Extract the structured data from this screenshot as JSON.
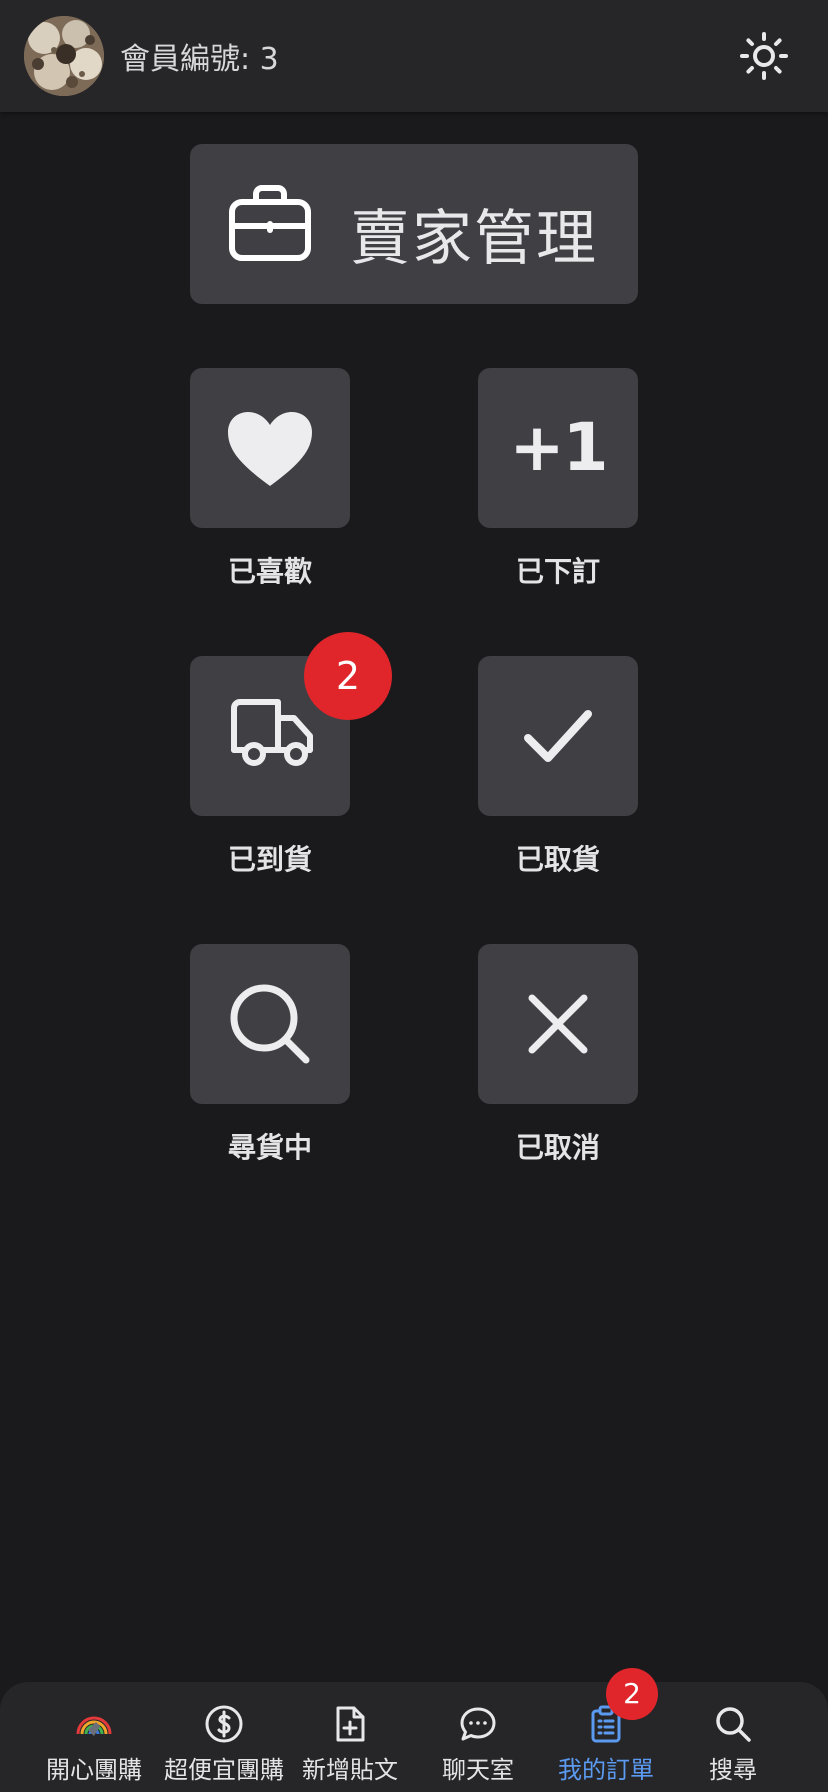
{
  "header": {
    "member_label": "會員編號: 3",
    "avatar_icon": "user-avatar-photo",
    "theme_icon": "sun-icon"
  },
  "seller": {
    "label": "賣家管理",
    "icon": "briefcase-icon"
  },
  "tiles": [
    {
      "label": "已喜歡",
      "icon": "heart-icon"
    },
    {
      "label": "已下訂",
      "icon": "plus-one-icon",
      "icon_text": "+1"
    },
    {
      "label": "已到貨",
      "icon": "truck-icon",
      "badge": "2"
    },
    {
      "label": "已取貨",
      "icon": "check-icon"
    },
    {
      "label": "尋貨中",
      "icon": "search-icon"
    },
    {
      "label": "已取消",
      "icon": "close-icon"
    }
  ],
  "bottom_nav": {
    "items": [
      {
        "label": "開心團購",
        "icon": "rainbow-icon"
      },
      {
        "label": "超便宜團購",
        "icon": "dollar-circle-icon"
      },
      {
        "label": "新增貼文",
        "icon": "file-plus-icon"
      },
      {
        "label": "聊天室",
        "icon": "chat-bubble-icon"
      },
      {
        "label": "我的訂單",
        "icon": "clipboard-list-icon",
        "badge": "2",
        "active": true
      },
      {
        "label": "搜尋",
        "icon": "search-icon"
      }
    ]
  },
  "colors": {
    "background": "#1a1a1c",
    "surface": "#262629",
    "tile": "#3f3f44",
    "badge": "#e0262b",
    "active": "#5b9af0"
  }
}
